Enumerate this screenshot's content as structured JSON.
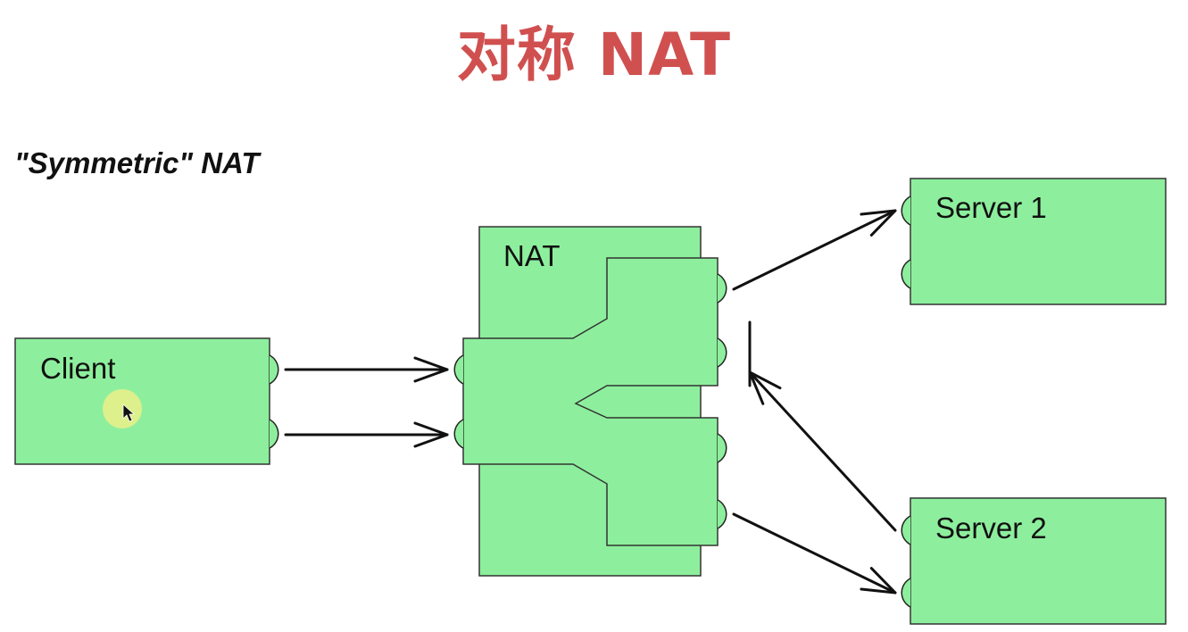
{
  "title": "对称 NAT",
  "subtitle": "\"Symmetric\" NAT",
  "colors": {
    "title": "#d05050",
    "box_fill": "#8def9d",
    "cursor_highlight": "#e6ef8a"
  },
  "nodes": {
    "client": {
      "label": "Client"
    },
    "nat": {
      "label": "NAT"
    },
    "server1": {
      "label": "Server 1"
    },
    "server2": {
      "label": "Server 2"
    }
  },
  "icons": {
    "cursor": "mouse-pointer-icon"
  }
}
